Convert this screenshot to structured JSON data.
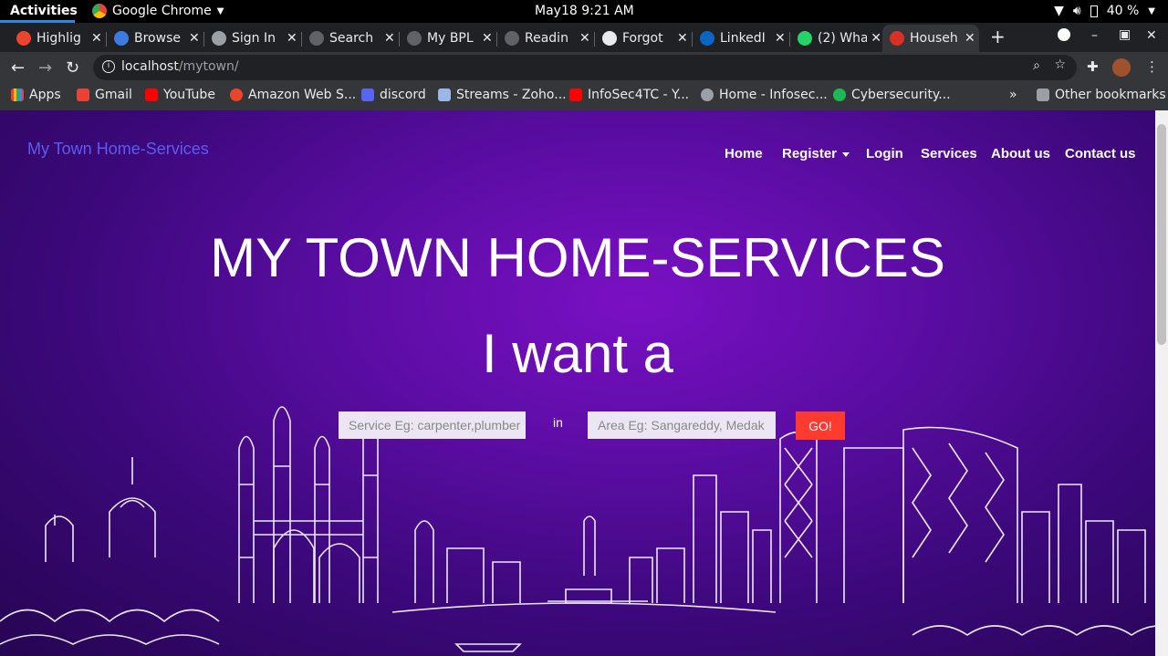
{
  "topbar": {
    "activities": "Activities",
    "app_name": "Google Chrome",
    "clock": "May18  9:21 AM",
    "battery": "40 %"
  },
  "tabs": [
    {
      "label": "Highlig",
      "color": "#e8452c"
    },
    {
      "label": "Browse",
      "color": "#3d7be0"
    },
    {
      "label": "Sign In",
      "color": "#9aa0a6"
    },
    {
      "label": "Search",
      "color": "#5f6368"
    },
    {
      "label": "My BPL",
      "color": "#5f6368"
    },
    {
      "label": "Readin",
      "color": "#5f6368"
    },
    {
      "label": "Forgot",
      "color": "#e8eaed"
    },
    {
      "label": "LinkedI",
      "color": "#0a66c2"
    },
    {
      "label": "(2) Wha",
      "color": "#25d366"
    },
    {
      "label": "Househ",
      "color": "#d93025"
    }
  ],
  "address": {
    "host": "localhost",
    "path": "/mytown/"
  },
  "bookmarks": [
    {
      "label": "Apps",
      "color": "#4285f4"
    },
    {
      "label": "Gmail",
      "color": "#ea4335"
    },
    {
      "label": "YouTube",
      "color": "#ff0000"
    },
    {
      "label": "Amazon Web S...",
      "color": "#e8452c"
    },
    {
      "label": "discord",
      "color": "#5865f2"
    },
    {
      "label": "Streams - Zoho...",
      "color": "#9ab7e8"
    },
    {
      "label": "InfoSec4TC - Y...",
      "color": "#ff0000"
    },
    {
      "label": "Home - Infosec...",
      "color": "#9aa0a6"
    },
    {
      "label": "Cybersecurity...",
      "color": "#1db954"
    }
  ],
  "bookmarks_overflow": "»",
  "other_bookmarks": "Other bookmarks",
  "site": {
    "brand": "My Town Home-Services",
    "nav": {
      "home": "Home",
      "register": "Register",
      "login": "Login",
      "services": "Services",
      "about": "About us",
      "contact": "Contact us"
    },
    "hero_title": "MY TOWN HOME-SERVICES",
    "hero_sub": "I want a",
    "search": {
      "service_placeholder": "Service Eg: carpenter,plumber",
      "in_label": "in",
      "area_placeholder": "Area Eg: Sangareddy, Medak",
      "go": "GO!"
    }
  }
}
